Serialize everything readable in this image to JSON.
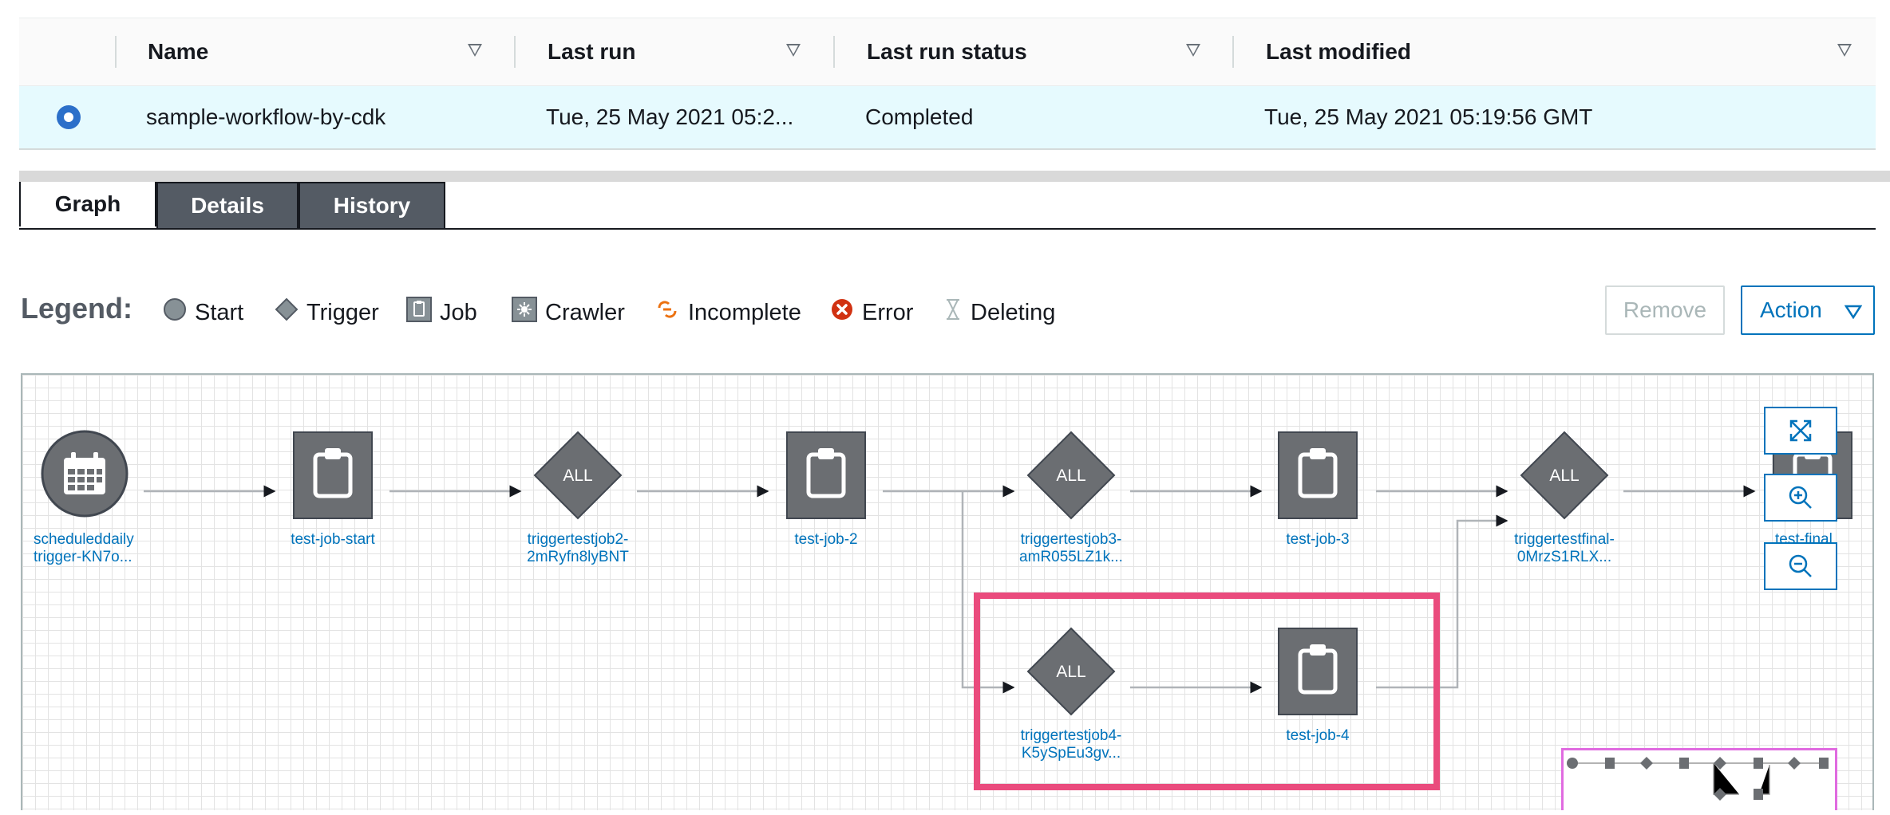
{
  "table": {
    "columns": [
      "Name",
      "Last run",
      "Last run status",
      "Last modified"
    ],
    "row": {
      "name": "sample-workflow-by-cdk",
      "last_run": "Tue, 25 May 2021 05:2...",
      "last_run_status": "Completed",
      "last_modified": "Tue, 25 May 2021 05:19:56 GMT"
    }
  },
  "tabs": [
    {
      "label": "Graph",
      "active": true
    },
    {
      "label": "Details",
      "active": false
    },
    {
      "label": "History",
      "active": false
    }
  ],
  "legend": {
    "title": "Legend:",
    "items": [
      {
        "icon": "start-circle-icon",
        "label": "Start"
      },
      {
        "icon": "trigger-diamond-icon",
        "label": "Trigger"
      },
      {
        "icon": "job-clipboard-icon",
        "label": "Job"
      },
      {
        "icon": "crawler-icon",
        "label": "Crawler"
      },
      {
        "icon": "incomplete-icon",
        "label": "Incomplete"
      },
      {
        "icon": "error-icon",
        "label": "Error"
      },
      {
        "icon": "hourglass-icon",
        "label": "Deleting"
      }
    ]
  },
  "buttons": {
    "remove": "Remove",
    "action": "Action"
  },
  "graph": {
    "nodes": [
      {
        "type": "start",
        "label_lines": [
          "scheduleddaily",
          "trigger-KN7o..."
        ]
      },
      {
        "type": "job",
        "label_lines": [
          "test-job-start"
        ]
      },
      {
        "type": "trigger",
        "text": "ALL",
        "label_lines": [
          "triggertestjob2-",
          "2mRyfn8lyBNT"
        ]
      },
      {
        "type": "job",
        "label_lines": [
          "test-job-2"
        ]
      },
      {
        "type": "trigger",
        "text": "ALL",
        "label_lines": [
          "triggertestjob3-",
          "amR055LZ1k..."
        ]
      },
      {
        "type": "job",
        "label_lines": [
          "test-job-3"
        ]
      },
      {
        "type": "trigger",
        "text": "ALL",
        "label_lines": [
          "triggertestfinal-",
          "0MrzS1RLX..."
        ]
      },
      {
        "type": "job",
        "label_lines": [
          "test-final"
        ]
      },
      {
        "type": "trigger",
        "text": "ALL",
        "label_lines": [
          "triggertestjob4-",
          "K5ySpEu3gv..."
        ]
      },
      {
        "type": "job",
        "label_lines": [
          "test-job-4"
        ]
      }
    ]
  },
  "colors": {
    "accent": "#0073bb",
    "node_fill": "#6b6e72",
    "selected_row": "#e6fafe",
    "highlight": "#ea4b7d",
    "minimap_border": "#e06be0"
  }
}
